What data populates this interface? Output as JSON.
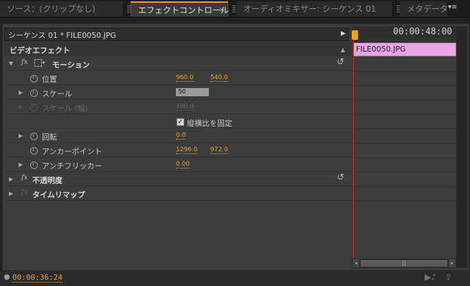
{
  "tabs": [
    {
      "label": "ソース：(クリップなし)"
    },
    {
      "label": "エフェクトコントロール",
      "close": "×"
    },
    {
      "label": "オーディオミキサー: シーケンス 01"
    },
    {
      "label": "メタデータ"
    }
  ],
  "tab_menu_icon": "▾≡",
  "sequence": {
    "title": "シーケンス 01 * FILE0050.JPG",
    "arrow": "▶"
  },
  "timeline": {
    "timecode": "00:00:48:00",
    "clip_name": "FILE0050.JPG"
  },
  "section": {
    "title": "ビデオエフェクト",
    "collapse": "▲"
  },
  "motion": {
    "fx": "fx",
    "label": "モーション",
    "reset": "↺"
  },
  "position": {
    "label": "位置",
    "x": "960.0",
    "y": "540.0"
  },
  "scale": {
    "label": "スケール",
    "value": "50"
  },
  "scale_width": {
    "label": "スケール (幅)",
    "value": "100.0"
  },
  "uniform": {
    "check": "✓",
    "label": "縦横比を固定"
  },
  "rotation": {
    "label": "回転",
    "value": "0.0"
  },
  "anchor": {
    "label": "アンカーポイント",
    "x": "1296.0",
    "y": "972.0"
  },
  "flicker": {
    "label": "アンチフリッカー",
    "value": "0.00"
  },
  "opacity": {
    "fx": "fx",
    "label": "不透明度",
    "reset": "↺"
  },
  "timeremap": {
    "fx": "fx",
    "label": "タイムリマップ"
  },
  "footer": {
    "time": "00:00:36:24",
    "icon_play": "▶♪",
    "icon_export": "⇪"
  },
  "colors": {
    "accent": "#e8a317",
    "clip": "#e6a6e6",
    "playhead": "#c0302a"
  }
}
